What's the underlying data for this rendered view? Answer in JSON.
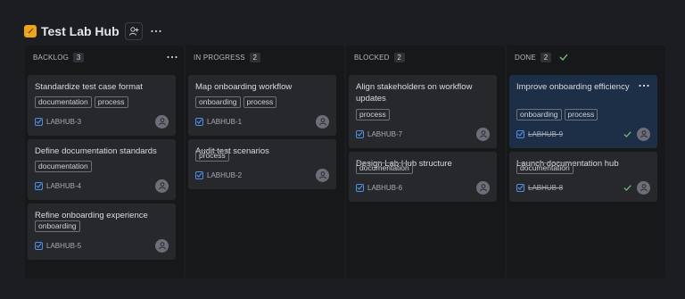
{
  "project": {
    "title": "Test Lab Hub",
    "icon": "notepad-icon",
    "icon_color": "#f0a70f"
  },
  "columns": [
    {
      "title": "BACKLOG",
      "count": "3",
      "cards": [
        {
          "title": "Standardize test case format",
          "tags": [
            "documentation",
            "process"
          ],
          "key": "LABHUB-3"
        },
        {
          "title": "Define documentation standards",
          "tags": [
            "documentation"
          ],
          "key": "LABHUB-4"
        },
        {
          "title": "Refine onboarding experience",
          "tags": [
            "onboarding"
          ],
          "key": "LABHUB-5"
        }
      ]
    },
    {
      "title": "IN PROGRESS",
      "count": "2",
      "cards": [
        {
          "title": "Map onboarding workflow",
          "tags": [
            "onboarding",
            "process"
          ],
          "key": "LABHUB-1"
        },
        {
          "title": "Audit test scenarios",
          "tags": [
            "process"
          ],
          "key": "LABHUB-2"
        }
      ]
    },
    {
      "title": "BLOCKED",
      "count": "2",
      "cards": [
        {
          "title": "Align stakeholders on workflow updates",
          "tags": [
            "process"
          ],
          "key": "LABHUB-7"
        },
        {
          "title": "Design Lab Hub structure",
          "tags": [
            "documentation"
          ],
          "key": "LABHUB-6"
        }
      ]
    },
    {
      "title": "DONE",
      "count": "2",
      "cards": [
        {
          "title": "Improve onboarding efficiency",
          "tags": [
            "onboarding",
            "process"
          ],
          "key": "LABHUB-9",
          "done": true,
          "selected": true
        },
        {
          "title": "Launch documentation hub",
          "tags": [
            "documentation"
          ],
          "key": "LABHUB-8",
          "done": true
        }
      ]
    }
  ],
  "colors": {
    "accent": "#4d8fe6",
    "done_green": "#7ec27a",
    "selected_card": "#1d2e47"
  }
}
